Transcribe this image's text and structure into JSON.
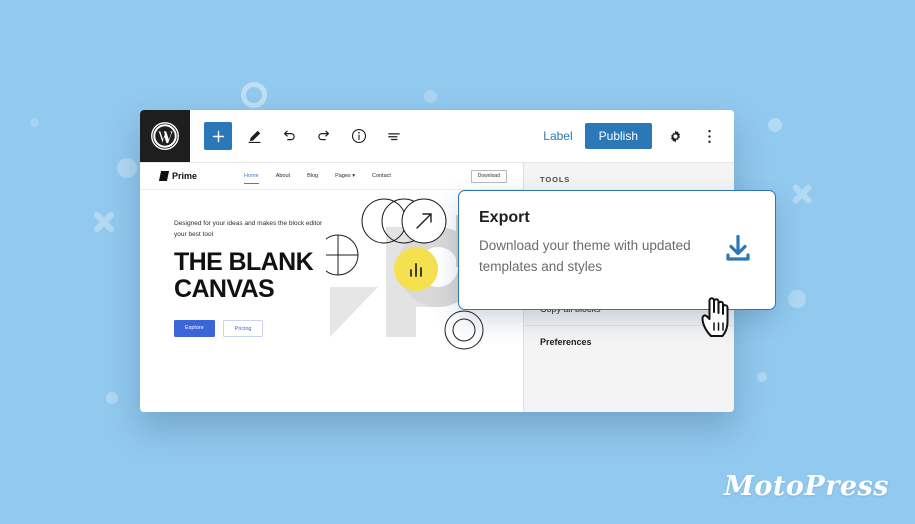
{
  "theme": {
    "background_color": "#92c9ef",
    "accent_blue": "#2a78b8",
    "link_blue": "#3a7fd5",
    "yellow": "#f5e050",
    "dark": "#1e1e1e"
  },
  "editor": {
    "logo_icon": "wordpress-icon",
    "toolbar_left": [
      {
        "icon": "plus-icon",
        "name": "add-block-button"
      },
      {
        "icon": "pencil-icon",
        "name": "edit-tool-button"
      },
      {
        "icon": "undo-icon",
        "name": "undo-button"
      },
      {
        "icon": "redo-icon",
        "name": "redo-button"
      },
      {
        "icon": "info-icon",
        "name": "details-button"
      },
      {
        "icon": "list-view-icon",
        "name": "list-view-button"
      }
    ],
    "label_text": "Label",
    "publish_text": "Publish",
    "settings_icon": "gear-icon",
    "more_icon": "kebab-menu-icon"
  },
  "site_preview": {
    "brand": "Prime",
    "nav": [
      {
        "label": "Home",
        "active": true
      },
      {
        "label": "About",
        "active": false
      },
      {
        "label": "Blog",
        "active": false
      },
      {
        "label": "Pages ▾",
        "active": false
      },
      {
        "label": "Contact",
        "active": false
      }
    ],
    "download_button": "Download",
    "hero": {
      "kicker": "Designed for your ideas and makes the block editor your best tool",
      "title_line1": "THE BLANK",
      "title_line2": "CANVAS",
      "primary_button": "Explore",
      "secondary_button": "Pricing",
      "art_icons": [
        "arrow-up-right-icon",
        "quadrant-circle-icon",
        "bar-chart-icon",
        "ring-icon"
      ]
    }
  },
  "side_panel": {
    "heading": "TOOLS",
    "items": [
      {
        "label": "Copy all blocks",
        "bold": false
      },
      {
        "label": "Preferences",
        "bold": true
      }
    ]
  },
  "export_popup": {
    "title": "Export",
    "description": "Download your theme with updated templates and styles",
    "icon": "download-icon"
  },
  "cursor": {
    "icon": "pointing-hand-cursor"
  },
  "branding": {
    "logo_text": "MotoPress"
  }
}
